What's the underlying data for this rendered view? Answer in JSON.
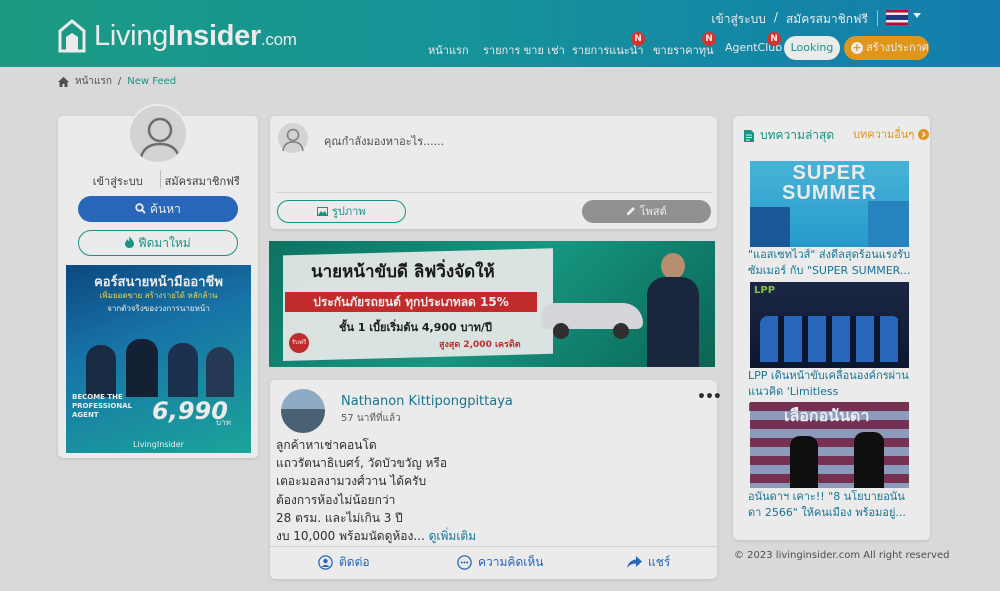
{
  "header": {
    "logo_light": "Living",
    "logo_bold": "Insider",
    "logo_domain": ".com",
    "login": "เข้าสู่ระบบ",
    "sep": "/",
    "register": "สมัครสมาชิกฟรี",
    "nav": [
      {
        "label": "หน้าแรก",
        "badge": ""
      },
      {
        "label": "รายการ ขาย เช่า",
        "badge": ""
      },
      {
        "label": "รายการแนะนำ",
        "badge": "N"
      },
      {
        "label": "ขายราคาทุน",
        "badge": "N"
      },
      {
        "label": "AgentClub",
        "badge": "N"
      }
    ],
    "looking": "Looking",
    "create": "สร้างประกาศ"
  },
  "breadcrumb": {
    "home": "หน้าแรก",
    "sep": "/",
    "current": "New Feed"
  },
  "left": {
    "login": "เข้าสู่ระบบ",
    "register": "สมัครสมาชิกฟรี",
    "search": "ค้นหา",
    "new": "ฟีดมาใหม่",
    "ad": {
      "title": "คอร์สนายหน้ามืออาชีพ",
      "line1": "เพิ่มยอดขาย สร้างรายได้ หลักล้าน",
      "line2": "จากตัวจริงของวงการนายหน้า",
      "become": "BECOME THE PROFESSIONAL AGENT",
      "price": "6,990",
      "unit": "บาท",
      "brand": "LivingInsider"
    }
  },
  "composer": {
    "placeholder": "คุณกำลังมองหาอะไร......",
    "photo": "รูปภาพ",
    "post": "โพสต์"
  },
  "banner": {
    "headline": "นายหน้าขับดี ลิฟวิ่งจัดให้",
    "sub": "ประกันภัยรถยนต์ ทุกประเภทลด 15%",
    "price": "ชั้น 1 เบี้ยเริ่มต้น 4,900 บาท/ปี",
    "free": "รับฟรี",
    "credit": "สูงสุด 2,000 เครดิต"
  },
  "feed": {
    "name": "Nathanon Kittipongpittaya",
    "time": "57 นาทีที่แล้ว",
    "lines": [
      "ลูกค้าหาเช่าคอนโด",
      "แถวรัตนาธิเบศร์, วัดบัวขวัญ หรือ",
      "เตอะมอลงามวงศ์วาน ได้ครับ",
      "ต้องการห้องไม่น้อยกว่า",
      "28 ตรม. และไม่เกิน 3 ปี",
      "งบ 10,000 พร้อมนัดดูห้อง..."
    ],
    "more": "ดูเพิ่มเติม",
    "contact": "ติดต่อ",
    "comment": "ความคิดเห็น",
    "share": "แชร์"
  },
  "right": {
    "heading": "บทความล่าสุด",
    "all": "บทความอื่นๆ",
    "articles": [
      {
        "title": "\"แอสเซทไวส์\" ส่งดีลสุดร้อนแรงรับซัมเมอร์ กับ \"SUPER SUMMER...",
        "img_text": "SUPER SUMMER"
      },
      {
        "title": "LPP เดินหน้าขับเคลื่อนองค์กรผ่านแนวคิด 'Limitless PPossibilities'...",
        "img_text": "LPP"
      },
      {
        "title": "อนันดาฯ เคาะ!! \"8 นโยบายอนันดา 2566\" ให้คนเมือง พร้อมอยู่...",
        "img_text": "เลือกอนันดา"
      }
    ],
    "copyright": "© 2023 livinginsider.com All right reserved"
  },
  "colors": {
    "primary": "#1aa08e",
    "blue": "#2c6fc9",
    "orange": "#f4a21e",
    "badge": "#e53935"
  }
}
